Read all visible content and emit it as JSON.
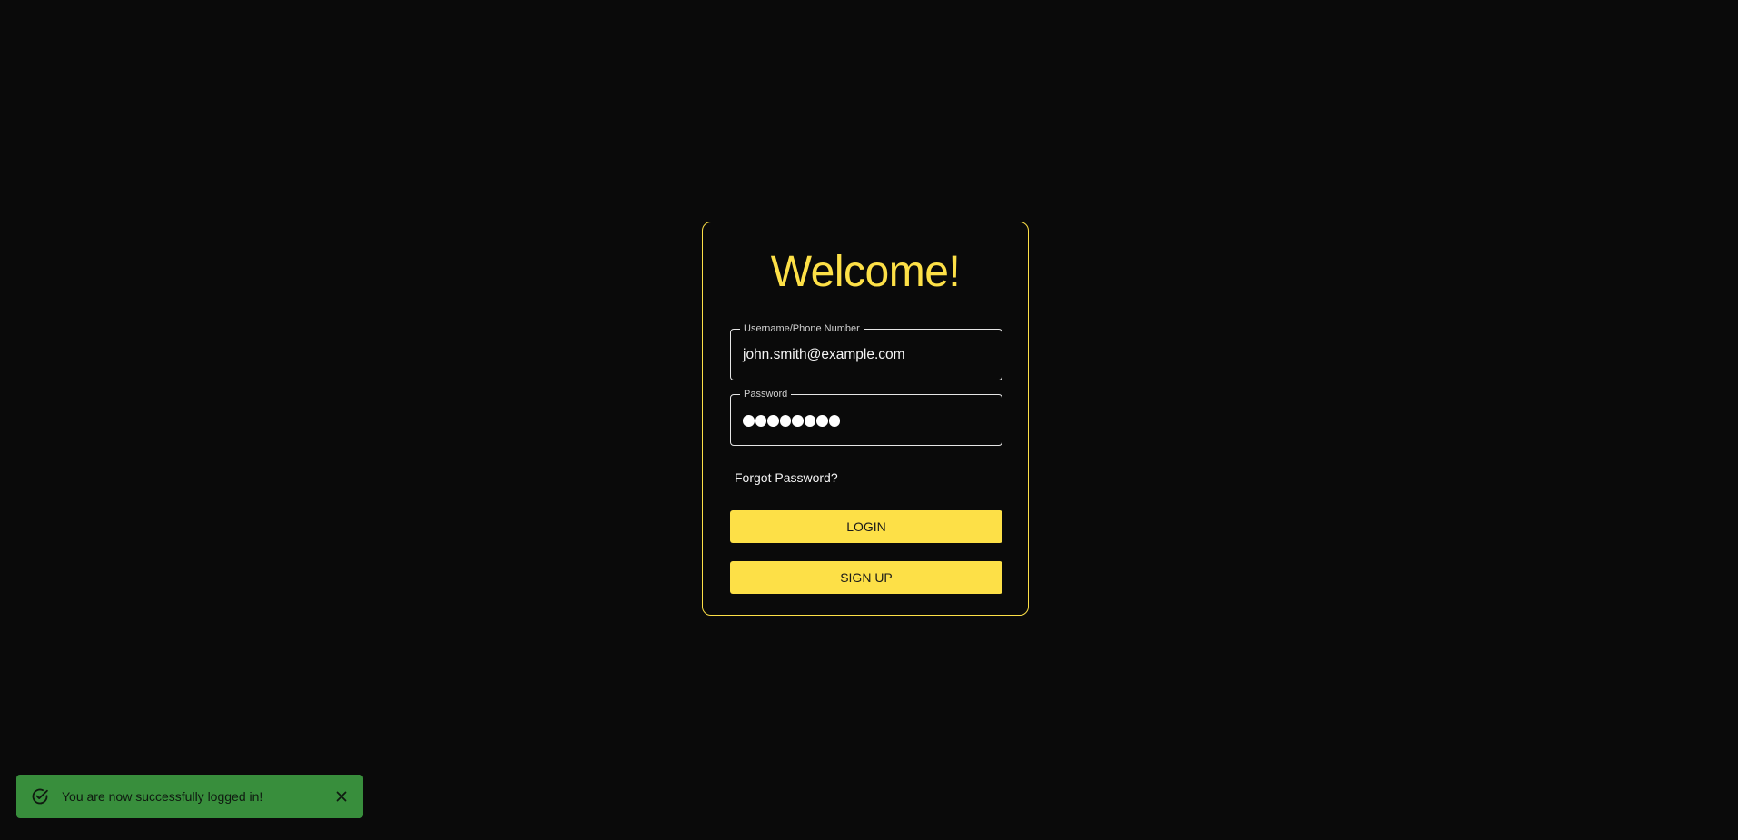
{
  "login_card": {
    "title": "Welcome!",
    "username_field": {
      "label": "Username/Phone Number",
      "value": "john.smith@example.com"
    },
    "password_field": {
      "label": "Password",
      "masked_char_count": 8
    },
    "forgot_password_link": "Forgot Password?",
    "login_button": "LOGIN",
    "signup_button": "SIGN UP"
  },
  "toast": {
    "message": "You are now successfully logged in!",
    "icon": "check-circle-icon",
    "close_icon": "close-icon"
  },
  "colors": {
    "background": "#0a0a0a",
    "accent": "#fde047",
    "toast_background": "#388e3c",
    "field_border": "#e5e5e5"
  }
}
